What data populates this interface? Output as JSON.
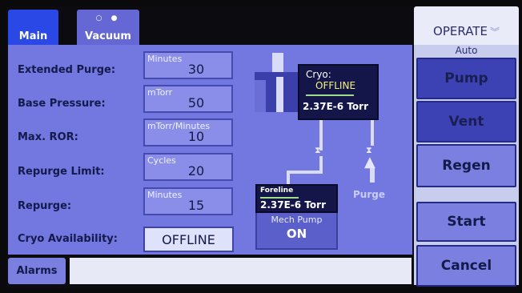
{
  "tabs": {
    "main": "Main",
    "vacuum": "Vacuum",
    "vacuum_dots": "○ ●"
  },
  "params": [
    {
      "label": "Extended Purge:",
      "unit": "Minutes",
      "value": "30"
    },
    {
      "label": "Base Pressure:",
      "unit": "mTorr",
      "value": "50"
    },
    {
      "label": "Max. ROR:",
      "unit": "mTorr/Minutes",
      "value": "10"
    },
    {
      "label": "Repurge Limit:",
      "unit": "Cycles",
      "value": "20"
    },
    {
      "label": "Repurge:",
      "unit": "Minutes",
      "value": "15"
    }
  ],
  "cryo_availability": {
    "label": "Cryo Availability:",
    "value": "OFFLINE"
  },
  "schematic": {
    "cryo_label": "Cryo:",
    "cryo_status": "OFFLINE",
    "cryo_pressure": "2.37E-6 Torr",
    "foreline_label": "Foreline",
    "foreline_pressure": "2.37E-6 Torr",
    "mech_pump_label": "Mech Pump",
    "mech_pump_status": "ON",
    "purge_label": "Purge"
  },
  "bottom": {
    "alarms": "Alarms"
  },
  "right": {
    "operate": "OPERATE",
    "mode": "Auto",
    "pump": "Pump",
    "vent": "Vent",
    "regen": "Regen",
    "start": "Start",
    "cancel": "Cancel"
  },
  "colors": {
    "panel": "#7278e0",
    "tab_active": "#2a48e6",
    "button_dark": "#3c42b4",
    "status_yellow": "#f6f37a"
  }
}
